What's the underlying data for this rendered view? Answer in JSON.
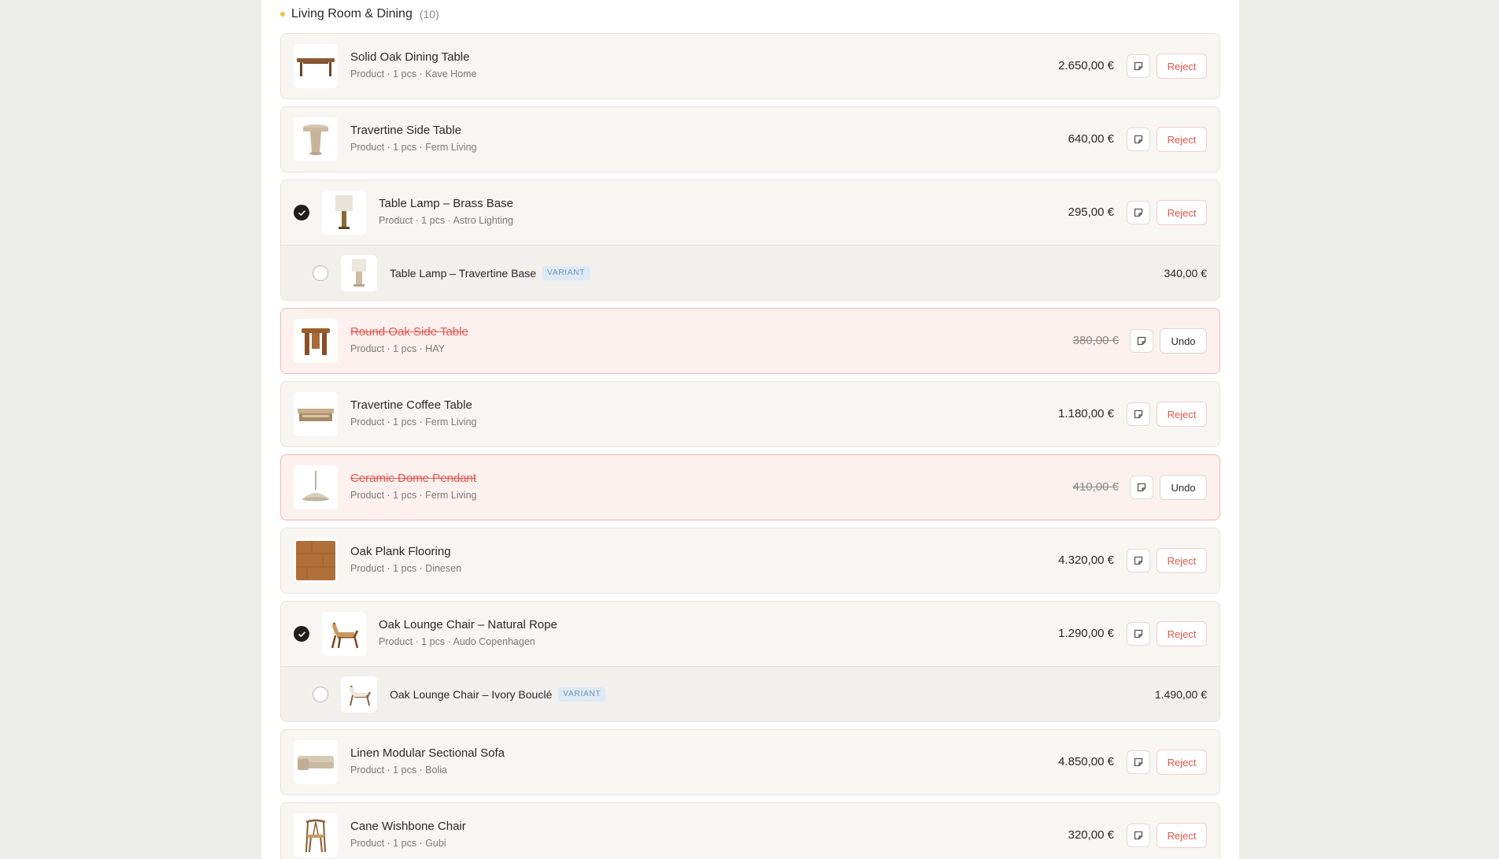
{
  "section": {
    "title": "Living Room & Dining",
    "count": "(10)",
    "accent_color": "#e8c547"
  },
  "actions": {
    "reject_label": "Reject",
    "undo_label": "Undo",
    "note_icon": "note-icon",
    "variant_badge": "VARIANT"
  },
  "items": [
    {
      "name": "Solid Oak Dining Table",
      "meta": "Product · 1 pcs · Kave Home",
      "price": "2.650,00 €",
      "status": "active",
      "selected": false
    },
    {
      "name": "Travertine Side Table",
      "meta": "Product · 1 pcs · Ferm Living",
      "price": "640,00 €",
      "status": "active",
      "selected": false
    },
    {
      "name": "Table Lamp – Brass Base",
      "meta": "Product · 1 pcs · Astro Lighting",
      "price": "295,00 €",
      "status": "active",
      "selected": true,
      "variant": {
        "name": "Table Lamp – Travertine Base",
        "price": "340,00 €",
        "selected": false
      }
    },
    {
      "name": "Round Oak Side Table",
      "meta": "Product · 1 pcs · HAY",
      "price": "380,00 €",
      "status": "rejected",
      "selected": false
    },
    {
      "name": "Travertine Coffee Table",
      "meta": "Product · 1 pcs · Ferm Living",
      "price": "1.180,00 €",
      "status": "active",
      "selected": false
    },
    {
      "name": "Ceramic Dome Pendant",
      "meta": "Product · 1 pcs · Ferm Living",
      "price": "410,00 €",
      "status": "rejected",
      "selected": false
    },
    {
      "name": "Oak Plank Flooring",
      "meta": "Product · 1 pcs · Dinesen",
      "price": "4.320,00 €",
      "status": "active",
      "selected": false
    },
    {
      "name": "Oak Lounge Chair – Natural Rope",
      "meta": "Product · 1 pcs · Audo Copenhagen",
      "price": "1.290,00 €",
      "status": "active",
      "selected": true,
      "variant": {
        "name": "Oak Lounge Chair – Ivory Bouclé",
        "price": "1.490,00 €",
        "selected": false
      }
    },
    {
      "name": "Linen Modular Sectional Sofa",
      "meta": "Product · 1 pcs · Bolia",
      "price": "4.850,00 €",
      "status": "active",
      "selected": false
    },
    {
      "name": "Cane Wishbone Chair",
      "meta": "Product · 1 pcs · Gubi",
      "price": "320,00 €",
      "status": "active",
      "selected": false
    }
  ]
}
